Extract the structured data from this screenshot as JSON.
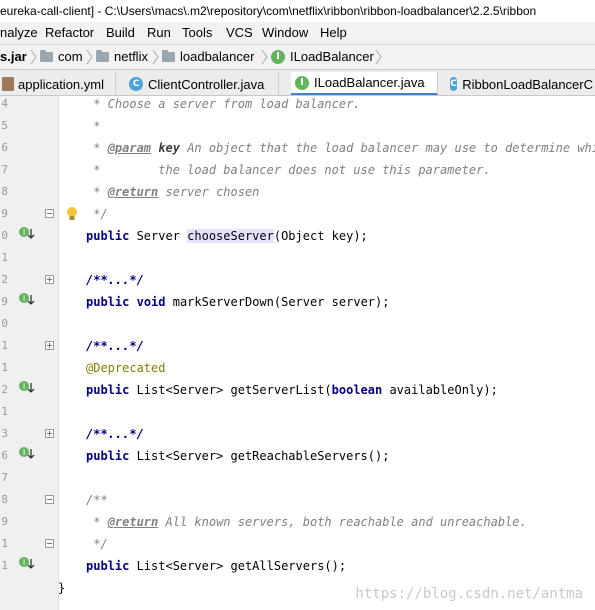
{
  "title_bar": {
    "text": "eureka-call-client] - C:\\Users\\macs\\.m2\\repository\\com\\netflix\\ribbon\\ribbon-loadbalancer\\2.2.5\\ribbon"
  },
  "menu": {
    "items": [
      {
        "label": "nalyze"
      },
      {
        "label": "Refactor"
      },
      {
        "label": "Build"
      },
      {
        "label": "Run"
      },
      {
        "label": "Tools"
      },
      {
        "label": "VCS"
      },
      {
        "label": "Window"
      },
      {
        "label": "Help"
      }
    ]
  },
  "breadcrumb": {
    "jar": "s.jar",
    "items": [
      {
        "label": "com"
      },
      {
        "label": "netflix"
      },
      {
        "label": "loadbalancer"
      },
      {
        "label": "ILoadBalancer"
      }
    ]
  },
  "tabs": [
    {
      "label": "application.yml",
      "active": false
    },
    {
      "label": "ClientController.java",
      "active": false
    },
    {
      "label": "ILoadBalancer.java",
      "active": true
    },
    {
      "label": "RibbonLoadBalancerC",
      "active": false
    }
  ],
  "gutter": {
    "line_numbers": [
      "4",
      "5",
      "6",
      "7",
      "8",
      "9",
      "0",
      "1",
      "2",
      "9",
      "0",
      "1",
      "1",
      "2",
      "1",
      "3",
      "6",
      "7",
      "8",
      "9",
      "1",
      "1"
    ]
  },
  "code": {
    "l1_comment": " * Choose a server from load balancer.",
    "l2_comment": " *",
    "l3_star": " * ",
    "l3_tag": "@param",
    "l3_name": "key",
    "l3_desc": " An object that the load balancer may use to determine which",
    "l4_comment": " *        the load balancer does not use this parameter.",
    "l5_star": " * ",
    "l5_tag": "@return",
    "l5_desc": " server chosen",
    "l6_comment": " */",
    "l7_kw": "public",
    "l7_pre": " Server ",
    "l7_method": "chooseServer",
    "l7_post": "(Object key);",
    "l9_fold": "/**...*/",
    "l10_kw1": "public",
    "l10_kw2": "void",
    "l10_rest": " markServerDown(Server server);",
    "l12_fold": "/**...*/",
    "l13_ann": "@Deprecated",
    "l14_kw": "public",
    "l14_pre": " List<Server> getServerList(",
    "l14_kw2": "boolean",
    "l14_post": " availableOnly);",
    "l16_fold": "/**...*/",
    "l17_kw": "public",
    "l17_rest": " List<Server> getReachableServers();",
    "l19_comment": "/**",
    "l20_star": " * ",
    "l20_tag": "@return",
    "l20_desc": " All known servers, both reachable and unreachable.",
    "l21_comment": " */",
    "l22_kw": "public",
    "l22_rest": " List<Server> getAllServers();",
    "l23_brace": "}"
  },
  "watermark": "https://blog.csdn.net/antma",
  "colors": {
    "keyword": "#000080",
    "comment": "#808080",
    "annotation": "#808000",
    "active_tab_underline": "#4083c9",
    "implementation_icon": "#61b55d"
  }
}
